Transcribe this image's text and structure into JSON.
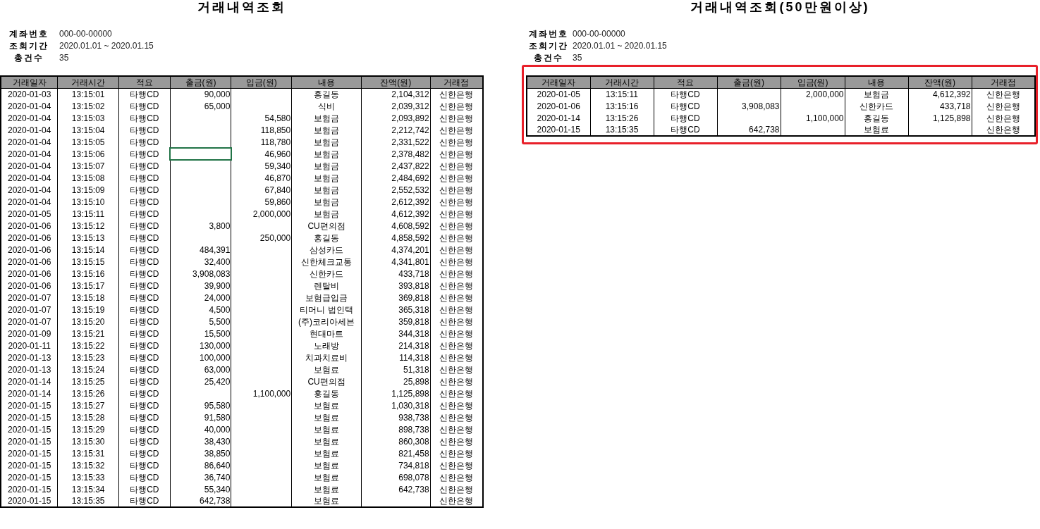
{
  "left_sheet": {
    "title": "거래내역조회",
    "info": [
      {
        "label": "계좌번호",
        "value": "000-00-00000"
      },
      {
        "label": "조회기간",
        "value": "2020.01.01 ~ 2020.01.15"
      },
      {
        "label": "총건수",
        "value": "35"
      }
    ],
    "columns": [
      "거래일자",
      "거래시간",
      "적요",
      "출금(원)",
      "입금(원)",
      "내용",
      "잔액(원)",
      "거래점"
    ],
    "rows": [
      {
        "date": "2020-01-03",
        "time": "13:15:01",
        "type": "타행CD",
        "withdrawal": "90,000",
        "memo": "홍길동",
        "balance": "2,104,312",
        "branch": "신한은행",
        "selected": false
      },
      {
        "date": "2020-01-04",
        "time": "13:15:02",
        "type": "타행CD",
        "withdrawal": "65,000",
        "memo": "식비",
        "balance": "2,039,312",
        "branch": "신한은행",
        "selected": false
      },
      {
        "date": "2020-01-04",
        "time": "13:15:03",
        "type": "타행CD",
        "deposit": "54,580",
        "memo": "보험금",
        "balance": "2,093,892",
        "branch": "신한은행",
        "selected": false
      },
      {
        "date": "2020-01-04",
        "time": "13:15:04",
        "type": "타행CD",
        "deposit": "118,850",
        "memo": "보험금",
        "balance": "2,212,742",
        "branch": "신한은행",
        "selected": false
      },
      {
        "date": "2020-01-04",
        "time": "13:15:05",
        "type": "타행CD",
        "deposit": "118,780",
        "memo": "보험금",
        "balance": "2,331,522",
        "branch": "신한은행",
        "selected": false
      },
      {
        "date": "2020-01-04",
        "time": "13:15:06",
        "type": "타행CD",
        "deposit": "46,960",
        "memo": "보험금",
        "balance": "2,378,482",
        "branch": "신한은행",
        "selected": true
      },
      {
        "date": "2020-01-04",
        "time": "13:15:07",
        "type": "타행CD",
        "deposit": "59,340",
        "memo": "보험금",
        "balance": "2,437,822",
        "branch": "신한은행",
        "selected": false
      },
      {
        "date": "2020-01-04",
        "time": "13:15:08",
        "type": "타행CD",
        "deposit": "46,870",
        "memo": "보험금",
        "balance": "2,484,692",
        "branch": "신한은행",
        "selected": false
      },
      {
        "date": "2020-01-04",
        "time": "13:15:09",
        "type": "타행CD",
        "deposit": "67,840",
        "memo": "보험금",
        "balance": "2,552,532",
        "branch": "신한은행",
        "selected": false
      },
      {
        "date": "2020-01-04",
        "time": "13:15:10",
        "type": "타행CD",
        "deposit": "59,860",
        "memo": "보험금",
        "balance": "2,612,392",
        "branch": "신한은행",
        "selected": false
      },
      {
        "date": "2020-01-05",
        "time": "13:15:11",
        "type": "타행CD",
        "deposit": "2,000,000",
        "memo": "보험금",
        "balance": "4,612,392",
        "branch": "신한은행",
        "selected": false
      },
      {
        "date": "2020-01-06",
        "time": "13:15:12",
        "type": "타행CD",
        "withdrawal": "3,800",
        "memo": "CU편의점",
        "balance": "4,608,592",
        "branch": "신한은행",
        "selected": false
      },
      {
        "date": "2020-01-06",
        "time": "13:15:13",
        "type": "타행CD",
        "deposit": "250,000",
        "memo": "홍길동",
        "balance": "4,858,592",
        "branch": "신한은행",
        "selected": false
      },
      {
        "date": "2020-01-06",
        "time": "13:15:14",
        "type": "타행CD",
        "withdrawal": "484,391",
        "memo": "삼성카드",
        "balance": "4,374,201",
        "branch": "신한은행",
        "selected": false
      },
      {
        "date": "2020-01-06",
        "time": "13:15:15",
        "type": "타행CD",
        "withdrawal": "32,400",
        "memo": "신한체크교통",
        "balance": "4,341,801",
        "branch": "신한은행",
        "selected": false
      },
      {
        "date": "2020-01-06",
        "time": "13:15:16",
        "type": "타행CD",
        "withdrawal": "3,908,083",
        "memo": "신한카드",
        "balance": "433,718",
        "branch": "신한은행",
        "selected": false
      },
      {
        "date": "2020-01-06",
        "time": "13:15:17",
        "type": "타행CD",
        "withdrawal": "39,900",
        "memo": "렌탈비",
        "balance": "393,818",
        "branch": "신한은행",
        "selected": false
      },
      {
        "date": "2020-01-07",
        "time": "13:15:18",
        "type": "타행CD",
        "withdrawal": "24,000",
        "memo": "보험급입금",
        "balance": "369,818",
        "branch": "신한은행",
        "selected": false
      },
      {
        "date": "2020-01-07",
        "time": "13:15:19",
        "type": "타행CD",
        "withdrawal": "4,500",
        "memo": "티머니 법인택",
        "balance": "365,318",
        "branch": "신한은행",
        "selected": false
      },
      {
        "date": "2020-01-07",
        "time": "13:15:20",
        "type": "타행CD",
        "withdrawal": "5,500",
        "memo": "(주)코리아세븐",
        "balance": "359,818",
        "branch": "신한은행",
        "selected": false
      },
      {
        "date": "2020-01-09",
        "time": "13:15:21",
        "type": "타행CD",
        "withdrawal": "15,500",
        "memo": "현대마트",
        "balance": "344,318",
        "branch": "신한은행",
        "selected": false
      },
      {
        "date": "2020-01-11",
        "time": "13:15:22",
        "type": "타행CD",
        "withdrawal": "130,000",
        "memo": "노래방",
        "balance": "214,318",
        "branch": "신한은행",
        "selected": false
      },
      {
        "date": "2020-01-13",
        "time": "13:15:23",
        "type": "타행CD",
        "withdrawal": "100,000",
        "memo": "치과치료비",
        "balance": "114,318",
        "branch": "신한은행",
        "selected": false
      },
      {
        "date": "2020-01-13",
        "time": "13:15:24",
        "type": "타행CD",
        "withdrawal": "63,000",
        "memo": "보험료",
        "balance": "51,318",
        "branch": "신한은행",
        "selected": false
      },
      {
        "date": "2020-01-14",
        "time": "13:15:25",
        "type": "타행CD",
        "withdrawal": "25,420",
        "memo": "CU편의점",
        "balance": "25,898",
        "branch": "신한은행",
        "selected": false
      },
      {
        "date": "2020-01-14",
        "time": "13:15:26",
        "type": "타행CD",
        "deposit": "1,100,000",
        "memo": "홍길동",
        "balance": "1,125,898",
        "branch": "신한은행",
        "selected": false
      },
      {
        "date": "2020-01-15",
        "time": "13:15:27",
        "type": "타행CD",
        "withdrawal": "95,580",
        "memo": "보험료",
        "balance": "1,030,318",
        "branch": "신한은행",
        "selected": false
      },
      {
        "date": "2020-01-15",
        "time": "13:15:28",
        "type": "타행CD",
        "withdrawal": "91,580",
        "memo": "보험료",
        "balance": "938,738",
        "branch": "신한은행",
        "selected": false
      },
      {
        "date": "2020-01-15",
        "time": "13:15:29",
        "type": "타행CD",
        "withdrawal": "40,000",
        "memo": "보험료",
        "balance": "898,738",
        "branch": "신한은행",
        "selected": false
      },
      {
        "date": "2020-01-15",
        "time": "13:15:30",
        "type": "타행CD",
        "withdrawal": "38,430",
        "memo": "보험료",
        "balance": "860,308",
        "branch": "신한은행",
        "selected": false
      },
      {
        "date": "2020-01-15",
        "time": "13:15:31",
        "type": "타행CD",
        "withdrawal": "38,850",
        "memo": "보험료",
        "balance": "821,458",
        "branch": "신한은행",
        "selected": false
      },
      {
        "date": "2020-01-15",
        "time": "13:15:32",
        "type": "타행CD",
        "withdrawal": "86,640",
        "memo": "보험료",
        "balance": "734,818",
        "branch": "신한은행",
        "selected": false
      },
      {
        "date": "2020-01-15",
        "time": "13:15:33",
        "type": "타행CD",
        "withdrawal": "36,740",
        "memo": "보험료",
        "balance": "698,078",
        "branch": "신한은행",
        "selected": false
      },
      {
        "date": "2020-01-15",
        "time": "13:15:34",
        "type": "타행CD",
        "withdrawal": "55,340",
        "memo": "보험료",
        "balance": "642,738",
        "branch": "신한은행",
        "selected": false
      },
      {
        "date": "2020-01-15",
        "time": "13:15:35",
        "type": "타행CD",
        "withdrawal": "642,738",
        "memo": "보험료",
        "branch": "신한은행",
        "selected": false
      }
    ]
  },
  "right_sheet": {
    "title": "거래내역조회(50만원이상)",
    "highlighted": true,
    "info": [
      {
        "label": "계좌번호",
        "value": "000-00-00000"
      },
      {
        "label": "조회기간",
        "value": "2020.01.01 ~ 2020.01.15"
      },
      {
        "label": "총건수",
        "value": "35"
      }
    ],
    "columns": [
      "거래일자",
      "거래시간",
      "적요",
      "출금(원)",
      "입금(원)",
      "내용",
      "잔액(원)",
      "거래점"
    ],
    "rows": [
      {
        "date": "2020-01-05",
        "time": "13:15:11",
        "type": "타행CD",
        "deposit": "2,000,000",
        "memo": "보험금",
        "balance": "4,612,392",
        "branch": "신한은행"
      },
      {
        "date": "2020-01-06",
        "time": "13:15:16",
        "type": "타행CD",
        "withdrawal": "3,908,083",
        "memo": "신한카드",
        "balance": "433,718",
        "branch": "신한은행"
      },
      {
        "date": "2020-01-14",
        "time": "13:15:26",
        "type": "타행CD",
        "deposit": "1,100,000",
        "memo": "홍길동",
        "balance": "1,125,898",
        "branch": "신한은행"
      },
      {
        "date": "2020-01-15",
        "time": "13:15:35",
        "type": "타행CD",
        "withdrawal": "642,738",
        "memo": "보험료",
        "branch": "신한은행"
      }
    ]
  }
}
